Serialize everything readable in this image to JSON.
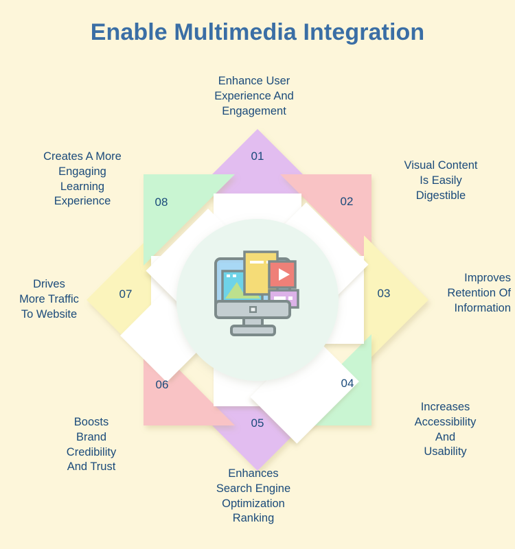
{
  "page": {
    "title": "Enable Multimedia Integration",
    "background_color": "#fdf6da",
    "title_color": "#3a6ea5",
    "label_color": "#1a4a7a"
  },
  "center": {
    "icon": "multimedia-monitor-icon",
    "circle_color": "#eaf6ef"
  },
  "palette": {
    "purple": "#e2bdf0",
    "pink": "#f9c3c5",
    "yellow": "#fbf4bc",
    "green": "#c9f5d2",
    "white": "#ffffff"
  },
  "chart_data": {
    "type": "diagram",
    "title": "Enable Multimedia Integration",
    "layout": "8-point star radial infographic",
    "steps": [
      {
        "number": "01",
        "label": "Enhance User\nExperience And\nEngagement",
        "color": "#e2bdf0",
        "color_name": "purple",
        "angle_deg": 0
      },
      {
        "number": "02",
        "label": "Visual Content\nIs Easily\nDigestible",
        "color": "#f9c3c5",
        "color_name": "pink",
        "angle_deg": 45
      },
      {
        "number": "03",
        "label": "Improves\nRetention Of\nInformation",
        "color": "#fbf4bc",
        "color_name": "yellow",
        "angle_deg": 90
      },
      {
        "number": "04",
        "label": "Increases\nAccessibility\nAnd\nUsability",
        "color": "#c9f5d2",
        "color_name": "green",
        "angle_deg": 135
      },
      {
        "number": "05",
        "label": "Enhances\nSearch Engine\nOptimization\nRanking",
        "color": "#e2bdf0",
        "color_name": "purple",
        "angle_deg": 180
      },
      {
        "number": "06",
        "label": "Boosts\nBrand\nCredibility\nAnd Trust",
        "color": "#f9c3c5",
        "color_name": "pink",
        "angle_deg": 225
      },
      {
        "number": "07",
        "label": "Drives\nMore Traffic\nTo Website",
        "color": "#fbf4bc",
        "color_name": "yellow",
        "angle_deg": 270
      },
      {
        "number": "08",
        "label": "Creates A More\nEngaging\nLearning\nExperience",
        "color": "#c9f5d2",
        "color_name": "green",
        "angle_deg": 315
      }
    ]
  }
}
